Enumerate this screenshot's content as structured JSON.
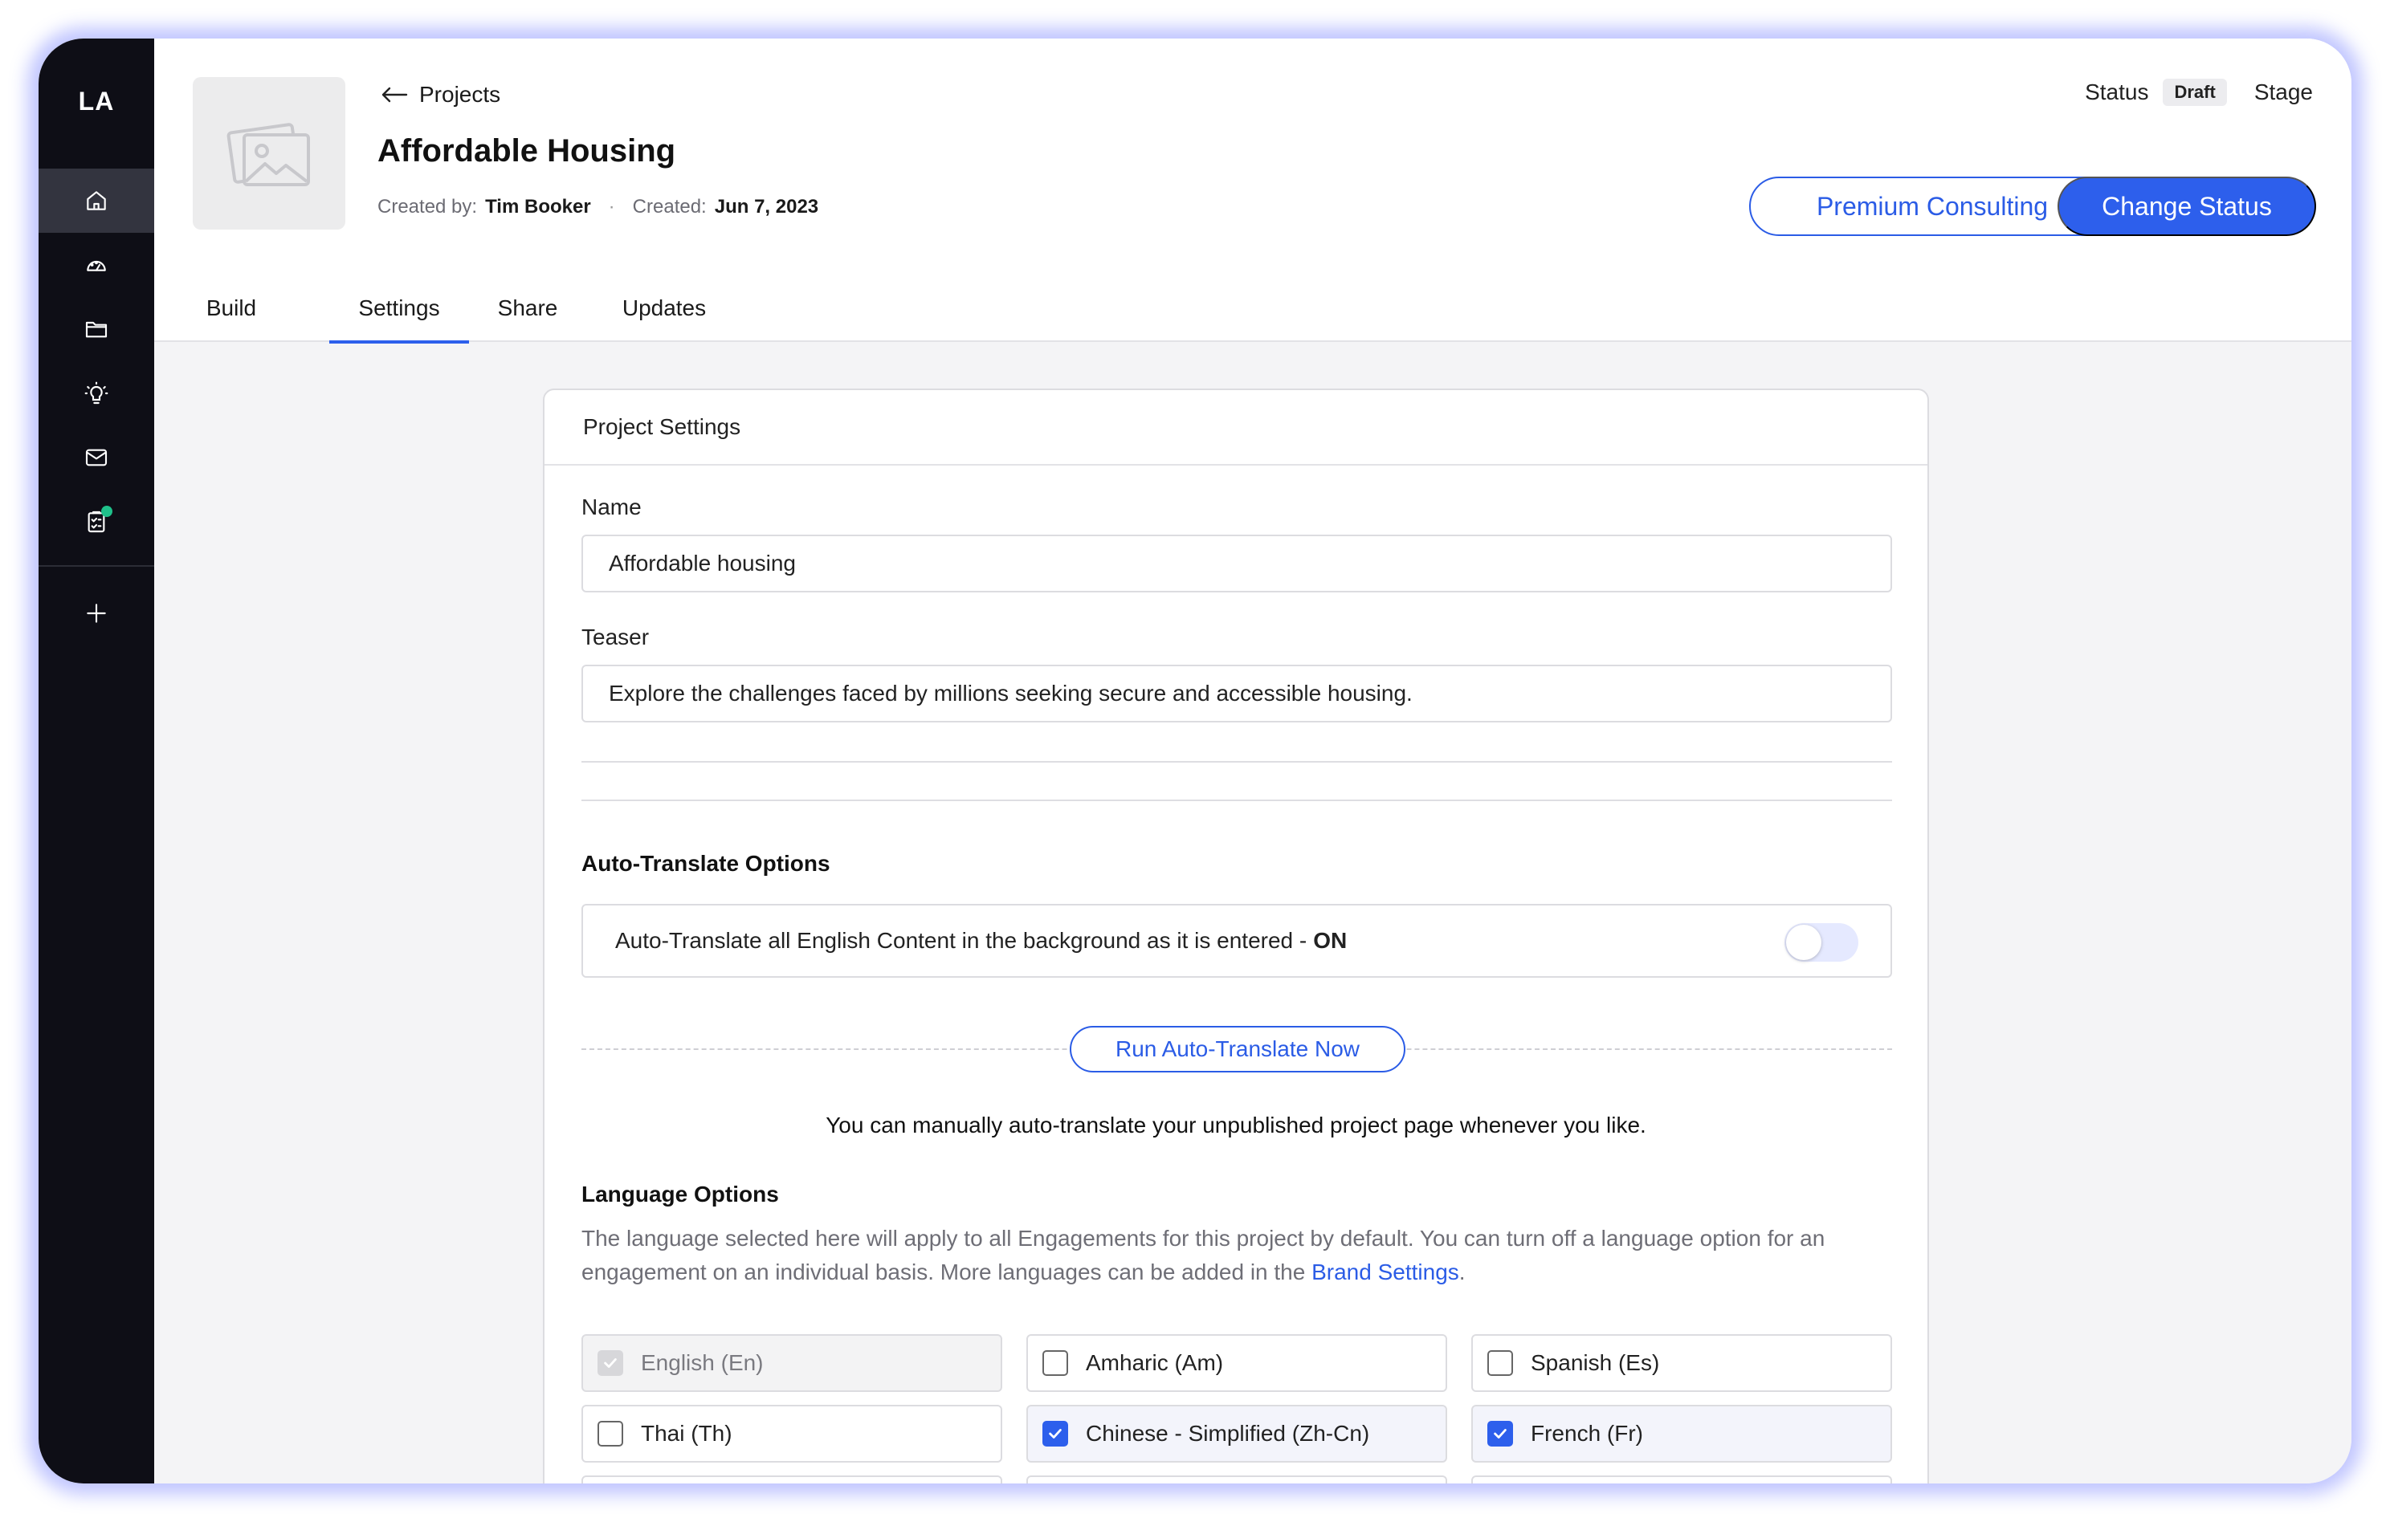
{
  "sidebar": {
    "logo": "LA",
    "items": [
      {
        "icon": "home-icon",
        "active": true
      },
      {
        "icon": "gauge-icon",
        "active": false
      },
      {
        "icon": "folder-icon",
        "active": false
      },
      {
        "icon": "lightbulb-icon",
        "active": false
      },
      {
        "icon": "mail-icon",
        "active": false
      },
      {
        "icon": "clipboard-icon",
        "active": false,
        "notification": true
      }
    ],
    "add_icon": "plus-icon"
  },
  "header": {
    "back_label": "Projects",
    "title": "Affordable Housing",
    "created_by_label": "Created by:",
    "created_by": "Tim Booker",
    "separator": "·",
    "created_label": "Created:",
    "created": "Jun 7, 2023",
    "status_label": "Status",
    "status_value": "Draft",
    "stage_label": "Stage",
    "premium_button": "Premium Consulting",
    "change_status_button": "Change Status"
  },
  "tabs": [
    {
      "label": "Build",
      "active": false
    },
    {
      "label": "Settings",
      "active": true
    },
    {
      "label": "Share",
      "active": false
    },
    {
      "label": "Updates",
      "active": false
    }
  ],
  "settings": {
    "card_title": "Project Settings",
    "name_label": "Name",
    "name_value": "Affordable housing",
    "teaser_label": "Teaser",
    "teaser_value": "Explore the challenges faced by millions seeking secure and accessible housing.",
    "auto_translate_title": "Auto-Translate Options",
    "auto_translate_text": "Auto-Translate all English Content in the background as it is entered -",
    "auto_translate_state": "ON",
    "run_button": "Run Auto-Translate Now",
    "manual_note": "You can manually auto-translate your unpublished project page whenever you like.",
    "language_title": "Language Options",
    "language_desc": "The language selected here will apply to all Engagements for this project by default. You can turn off a language option for an engagement on an individual basis. More languages can be added in the",
    "brand_link": "Brand Settings",
    "language_desc_end": ".",
    "languages": [
      {
        "label": "English (En)",
        "checked": true,
        "disabled": true
      },
      {
        "label": "Amharic (Am)",
        "checked": false,
        "disabled": false
      },
      {
        "label": "Spanish (Es)",
        "checked": false,
        "disabled": false
      },
      {
        "label": "Thai (Th)",
        "checked": false,
        "disabled": false
      },
      {
        "label": "Chinese - Simplified (Zh-Cn)",
        "checked": true,
        "disabled": false
      },
      {
        "label": "French (Fr)",
        "checked": true,
        "disabled": false
      }
    ]
  },
  "colors": {
    "accent": "#2d5fec",
    "sidebar_bg": "#0e0e16",
    "notification": "#1fc08a"
  }
}
